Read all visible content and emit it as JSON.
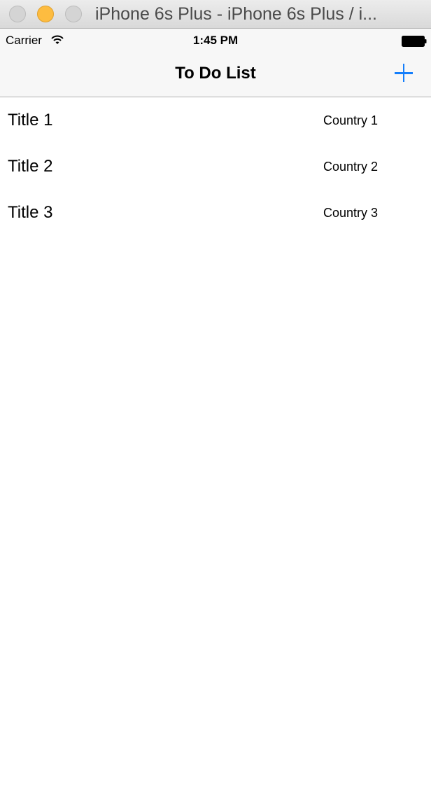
{
  "window": {
    "title": "iPhone 6s Plus - iPhone 6s Plus / i..."
  },
  "status_bar": {
    "carrier": "Carrier",
    "time": "1:45 PM"
  },
  "nav_bar": {
    "title": "To Do List",
    "add_icon": "plus-icon",
    "tint_color": "#147EFB"
  },
  "table": {
    "rows": [
      {
        "title": "Title 1",
        "detail": "Country 1"
      },
      {
        "title": "Title 2",
        "detail": "Country 2"
      },
      {
        "title": "Title 3",
        "detail": "Country 3"
      }
    ]
  }
}
